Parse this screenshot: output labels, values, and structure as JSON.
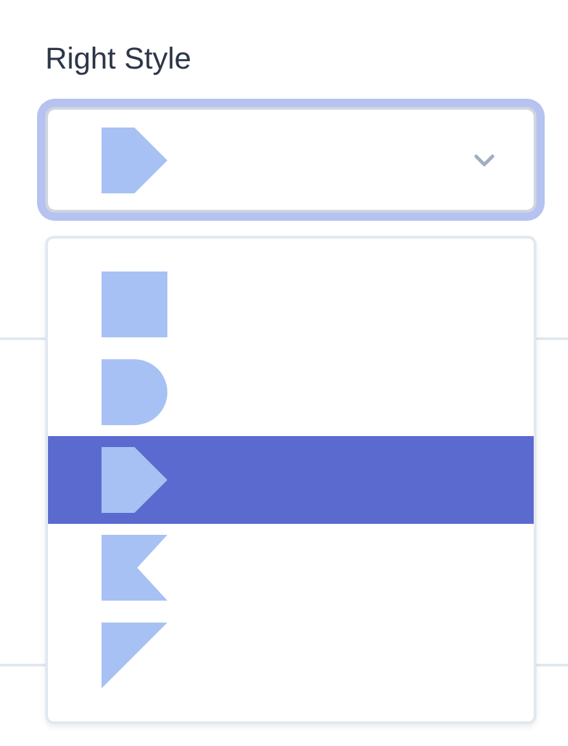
{
  "label": "Right Style",
  "select": {
    "kind": "arrow",
    "focused": true
  },
  "options": [
    {
      "kind": "square",
      "selected": false
    },
    {
      "kind": "round",
      "selected": false
    },
    {
      "kind": "arrow",
      "selected": true
    },
    {
      "kind": "notch",
      "selected": false
    },
    {
      "kind": "slant",
      "selected": false
    }
  ]
}
